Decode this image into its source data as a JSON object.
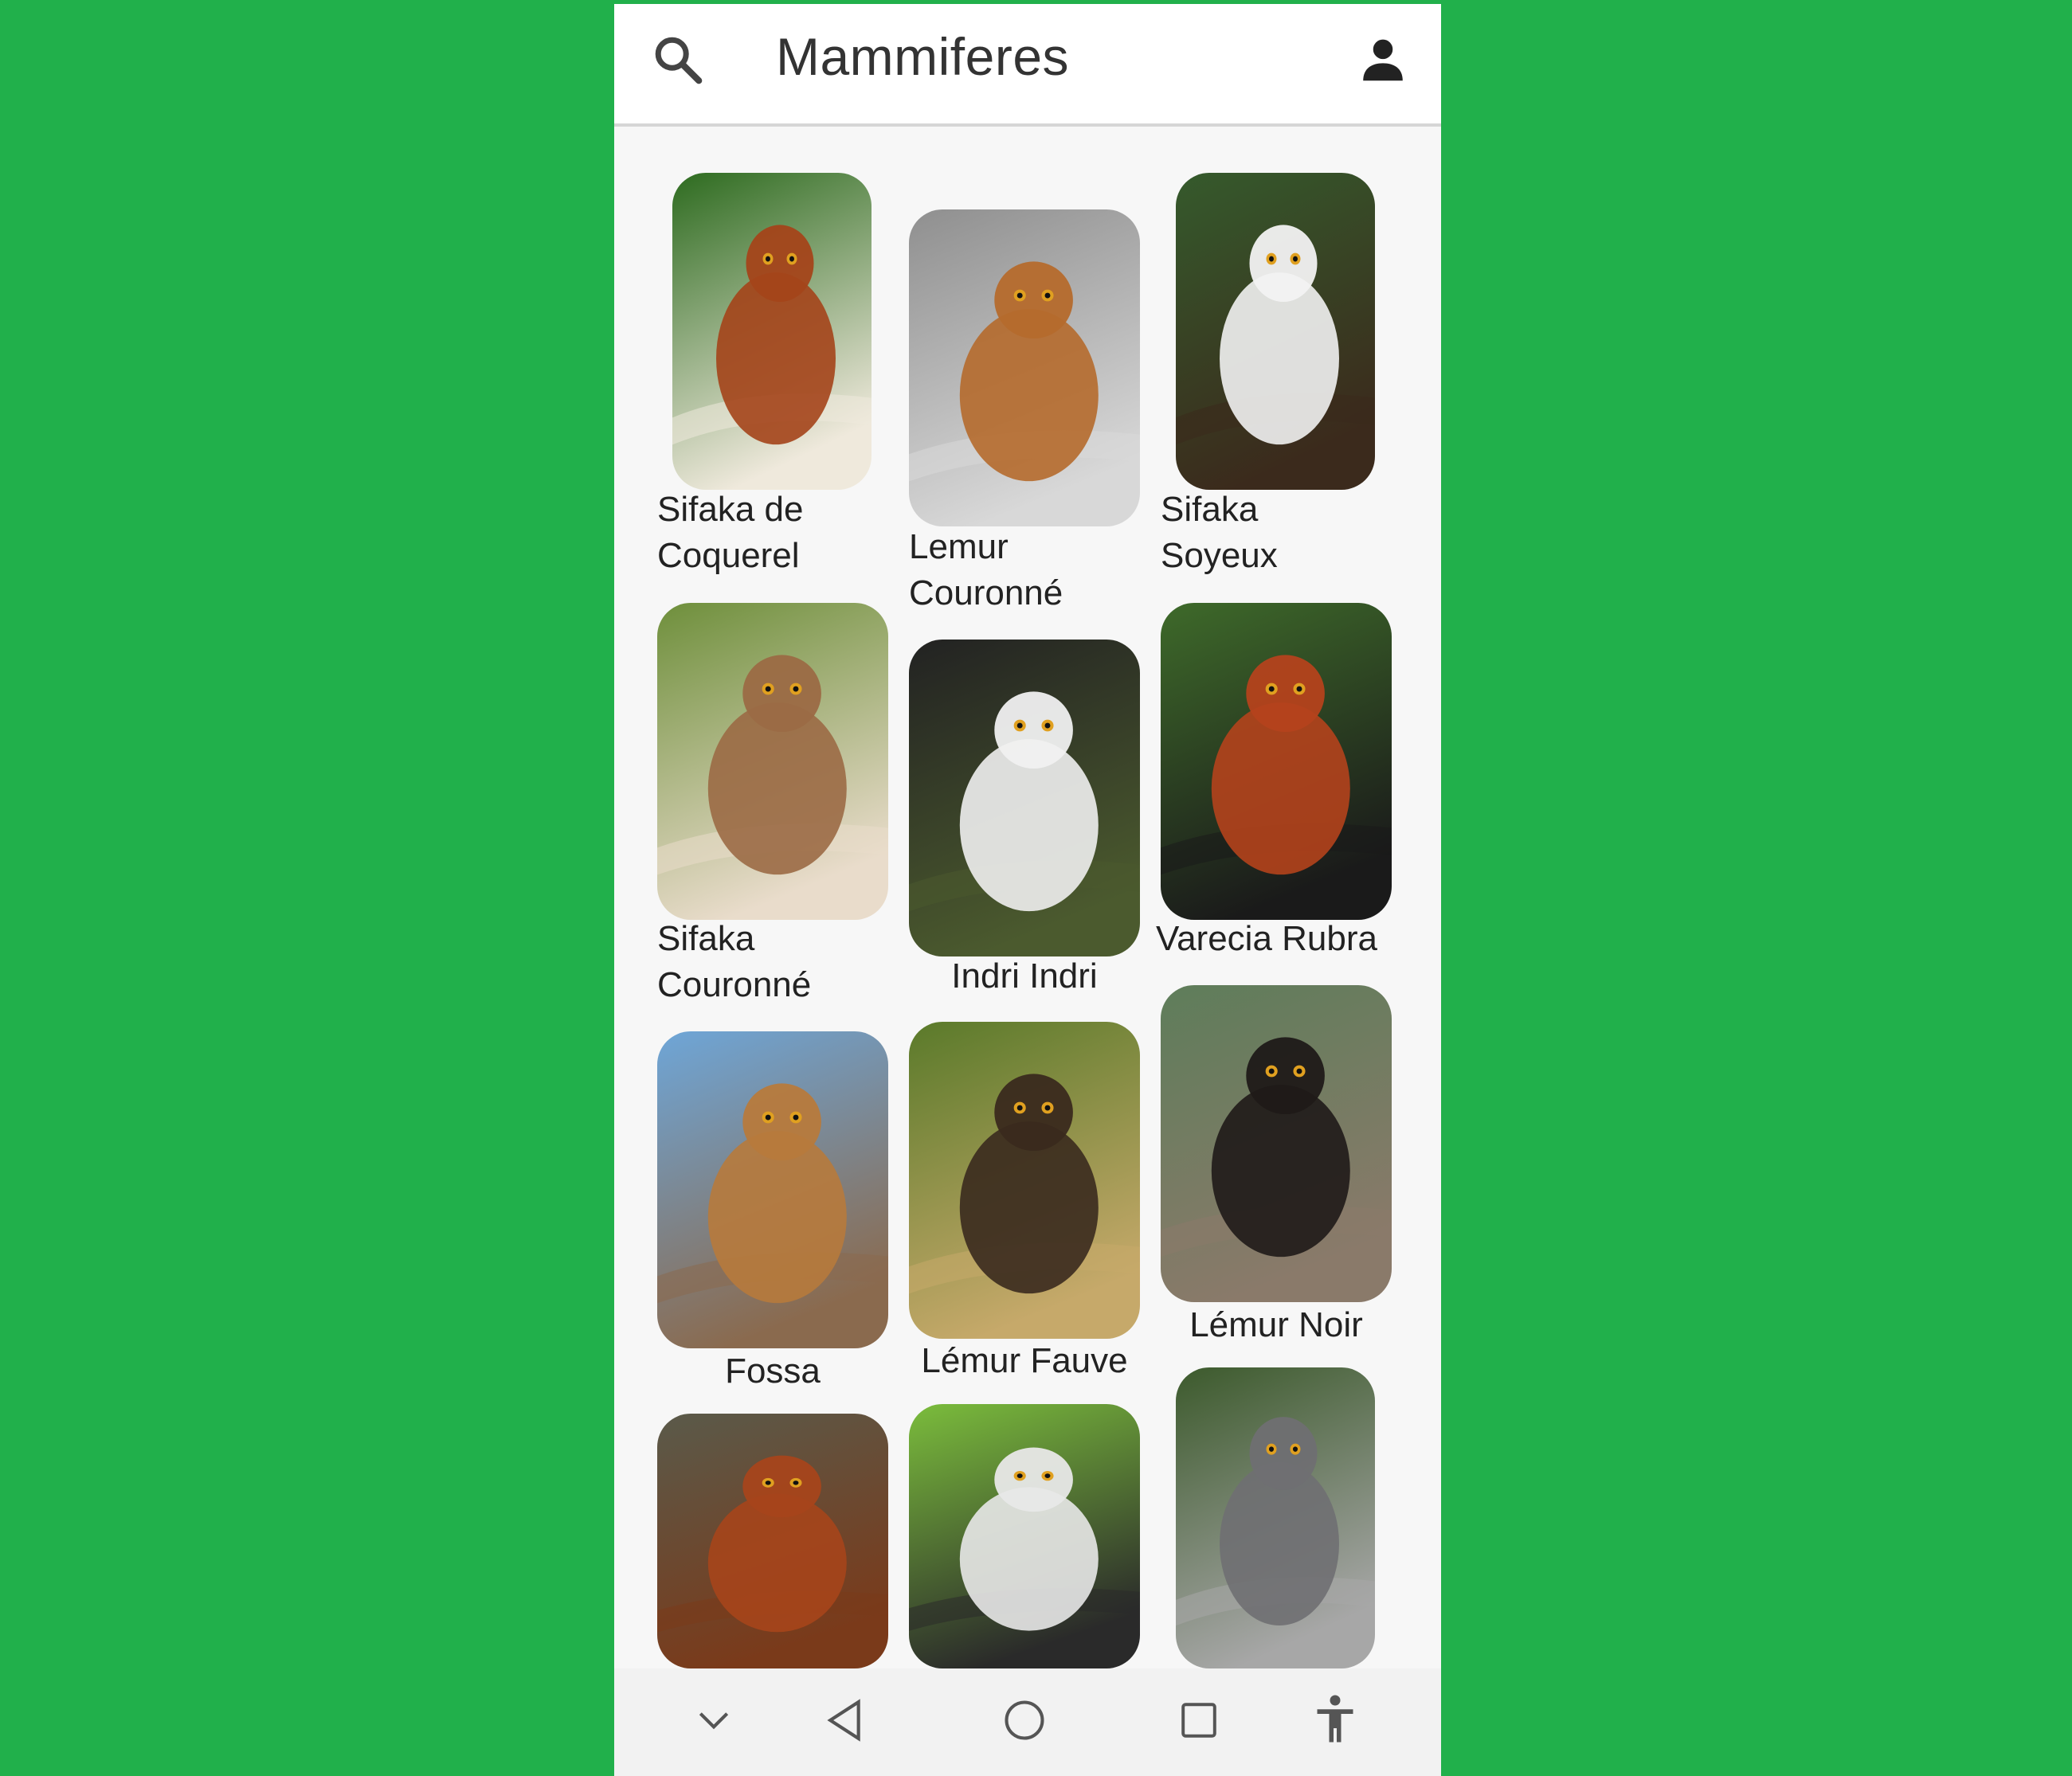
{
  "app": {
    "title": "Mammiferes",
    "accent": "#21b04b",
    "icons": {
      "search": "search-icon",
      "account": "account-icon"
    }
  },
  "animals": [
    {
      "name": "Sifaka de\nCoquerel",
      "palette": [
        "#2d6b1f",
        "#a4441a",
        "#efe9dc"
      ]
    },
    {
      "name": "Lemur\nCouronné",
      "palette": [
        "#8f8f8f",
        "#b56a2c",
        "#d8d8d8"
      ]
    },
    {
      "name": "Sifaka\nSoyeux",
      "palette": [
        "#355a2c",
        "#f2f2f2",
        "#3b2a1c"
      ]
    },
    {
      "name": "Sifaka\nCouronné",
      "palette": [
        "#6e8f3b",
        "#9b6a45",
        "#e9dccb"
      ]
    },
    {
      "name": "Indri Indri",
      "palette": [
        "#222222",
        "#f0f0f0",
        "#4b5a2e"
      ]
    },
    {
      "name": "Varecia Rubra",
      "palette": [
        "#3e6a2a",
        "#b4421c",
        "#1a1a1a"
      ]
    },
    {
      "name": "Fossa",
      "palette": [
        "#6ea6d8",
        "#b77a3c",
        "#8a6a4e"
      ]
    },
    {
      "name": "Lémur Fauve",
      "palette": [
        "#5a7a2a",
        "#3a2a1e",
        "#c6a96a"
      ]
    },
    {
      "name": "Lémur Noir",
      "palette": [
        "#5e7d5a",
        "#1f1a18",
        "#8a7a6a"
      ]
    },
    {
      "name": "",
      "palette": [
        "#5a5a4a",
        "#a6451b",
        "#7a3a1a"
      ]
    },
    {
      "name": "",
      "palette": [
        "#7bbd3c",
        "#e8e8e8",
        "#2a2a2a"
      ]
    },
    {
      "name": "",
      "palette": [
        "#3c5a2c",
        "#6f6f72",
        "#a7a7a7"
      ]
    }
  ],
  "navbar": {
    "icons": [
      "chevron-down-icon",
      "back-icon",
      "home-icon",
      "recents-icon",
      "accessibility-icon"
    ]
  }
}
